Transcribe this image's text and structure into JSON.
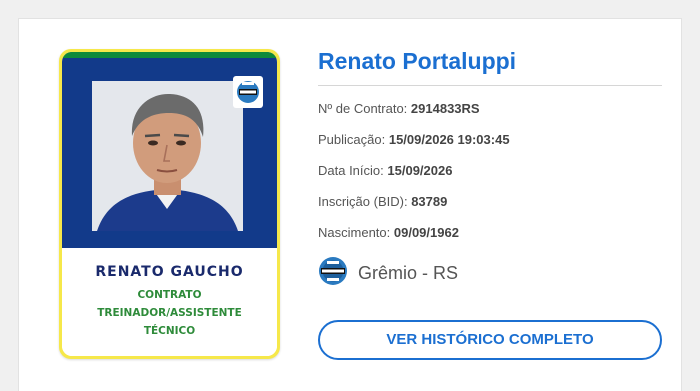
{
  "card": {
    "name": "RENATO GAUCHO",
    "role_line1": "CONTRATO",
    "role_line2": "TREINADOR/ASSISTENTE",
    "role_line3": "TÉCNICO",
    "badge_icon": "gremio-crest-icon",
    "colors": {
      "frame": "#f6e84a",
      "stripe": "#0f8a3a",
      "background": "#123a8a",
      "name": "#1a2a6c",
      "role": "#2e8b3a"
    }
  },
  "info": {
    "full_name": "Renato Portaluppi",
    "contract_label": "Nº de Contrato:",
    "contract_value": "2914833RS",
    "publication_label": "Publicação:",
    "publication_value": "15/09/2026 19:03:45",
    "start_label": "Data Início:",
    "start_value": "15/09/2026",
    "registration_label": "Inscrição (BID):",
    "registration_value": "83789",
    "birth_label": "Nascimento:",
    "birth_value": "09/09/1962",
    "club_icon": "gremio-crest-icon",
    "club_name": "Grêmio - RS"
  },
  "actions": {
    "history_button": "VER HISTÓRICO COMPLETO"
  },
  "colors": {
    "accent": "#1b6fd1"
  }
}
